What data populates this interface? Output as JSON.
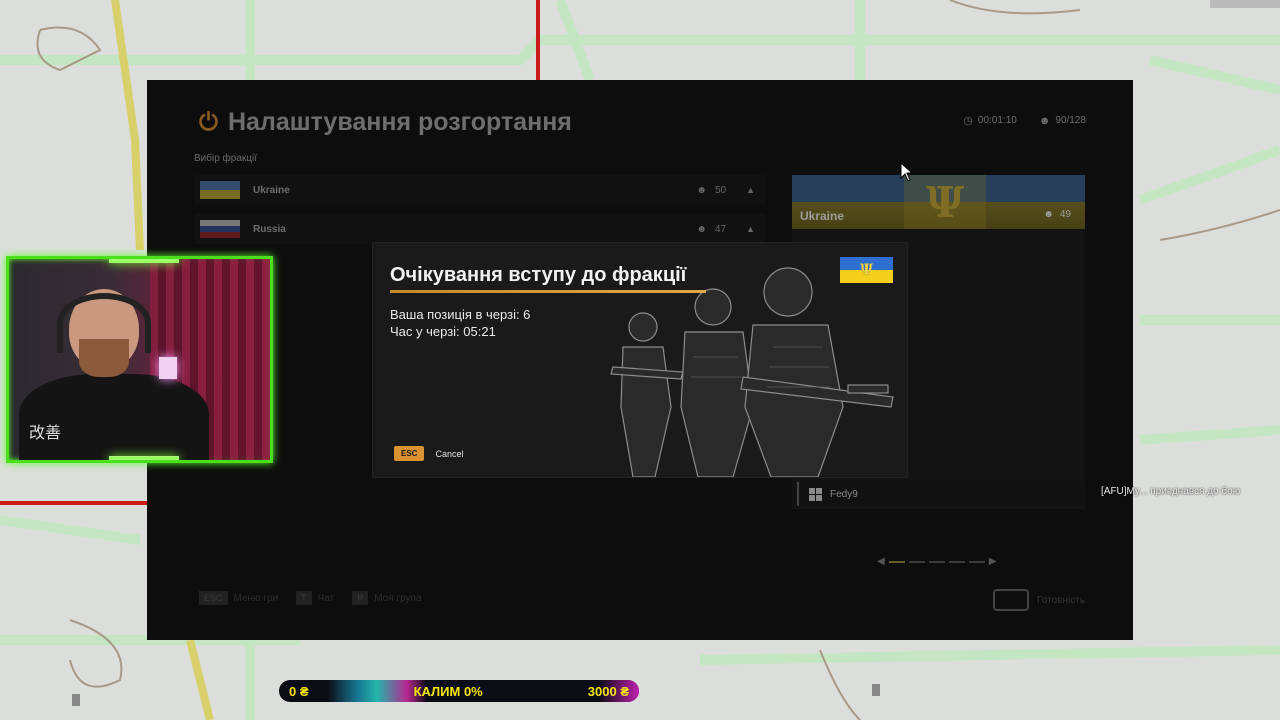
{
  "panel": {
    "title": "Налаштування розгортання",
    "timer": "00:01:10",
    "players": "90/128",
    "section_label": "Вибір фракції",
    "factions": [
      {
        "name": "Ukraine",
        "count": "50"
      },
      {
        "name": "Russia",
        "count": "47"
      }
    ],
    "selected_faction": {
      "name": "Ukraine",
      "count": "49"
    },
    "player_list": [
      {
        "name": "Fedy9"
      }
    ],
    "footer_hints": [
      {
        "key": "ESC",
        "label": "Меню гри"
      },
      {
        "key": "T",
        "label": "Чат"
      },
      {
        "key": "P",
        "label": "Моя група"
      }
    ],
    "ready_label": "Готовність"
  },
  "modal": {
    "title": "Очікування вступу до фракції",
    "queue_position": "Ваша позиція в черзі: 6",
    "queue_time": "Час у черзі: 05:21",
    "esc_key": "ESC",
    "cancel_label": "Cancel"
  },
  "chat": {
    "line": "[AFU]My... приєднався до бою"
  },
  "donation_bar": {
    "left": "0 ₴",
    "center": "КАЛИМ 0%",
    "right": "3000 ₴",
    "progress_percent": 0
  },
  "colors": {
    "accent": "#e0a840",
    "webcam_border": "#4ce01c",
    "donation_text": "#f5e70e"
  }
}
